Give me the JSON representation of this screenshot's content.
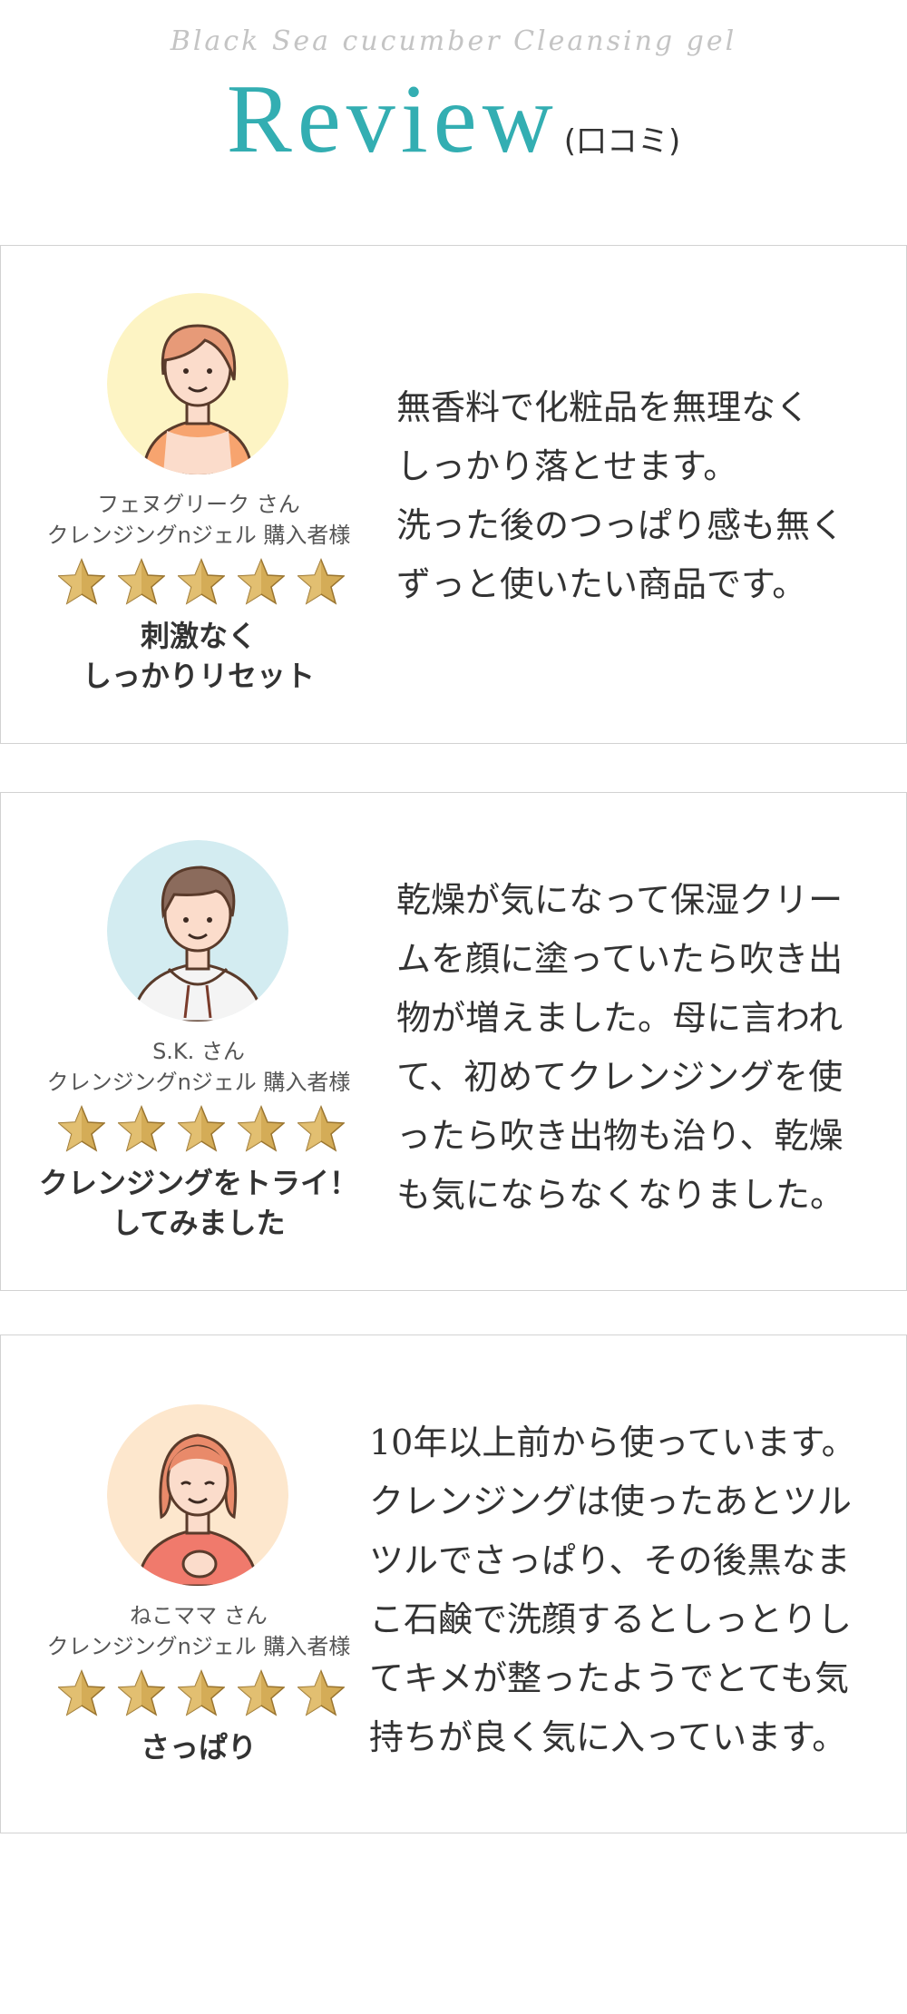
{
  "header": {
    "subtitle": "Black Sea cucumber Cleansing gel",
    "title": "Review",
    "title_jp": "(口コミ)"
  },
  "colors": {
    "accent": "#33aeb2",
    "border": "#d2d2d2",
    "star_gold": "#c9a14a"
  },
  "reviews": [
    {
      "name": "フェヌグリーク さん",
      "product": "クレンジングnジェル 購入者様",
      "rating": 5,
      "headline_lines": [
        "刺激なく",
        "しっかりリセット"
      ],
      "body_lines": [
        "無香料で化粧品を無理なく",
        "しっかり落とせます。",
        "洗った後のつっぱり感も無く",
        "ずっと使いたい商品です。"
      ],
      "avatar_bg": "#fdf4c4"
    },
    {
      "name": "S.K. さん",
      "product": "クレンジングnジェル 購入者様",
      "rating": 5,
      "headline_lines": [
        "クレンジングをトライ！",
        "してみました"
      ],
      "body_lines": [
        "乾燥が気になって保湿クリー",
        "ムを顔に塗っていたら吹き出",
        "物が増えました。母に言われ",
        "て、初めてクレンジングを使",
        "ったら吹き出物も治り、乾燥",
        "も気にならなくなりました。"
      ],
      "avatar_bg": "#d3ecf1"
    },
    {
      "name": "ねこママ さん",
      "product": "クレンジングnジェル 購入者様",
      "rating": 5,
      "headline_lines": [
        "さっぱり"
      ],
      "body_lines": [
        "10年以上前から使っています。",
        "クレンジングは使ったあとツル",
        "ツルでさっぱり、その後黒なま",
        "こ石鹸で洗顔するとしっとりし",
        "てキメが整ったようでとても気",
        "持ちが良く気に入っています。"
      ],
      "avatar_bg": "#fde7cd"
    }
  ]
}
